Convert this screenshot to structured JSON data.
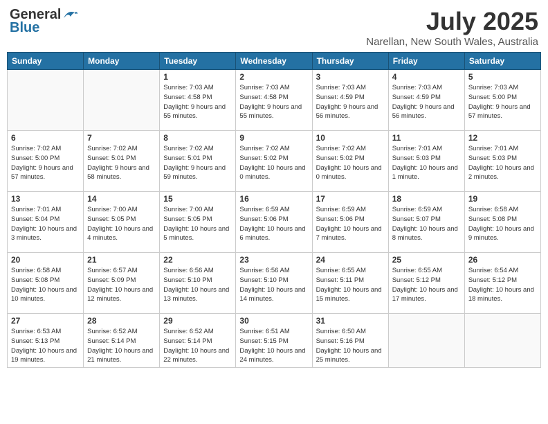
{
  "header": {
    "logo_general": "General",
    "logo_blue": "Blue",
    "month_year": "July 2025",
    "location": "Narellan, New South Wales, Australia"
  },
  "columns": [
    "Sunday",
    "Monday",
    "Tuesday",
    "Wednesday",
    "Thursday",
    "Friday",
    "Saturday"
  ],
  "weeks": [
    [
      {
        "day": "",
        "info": ""
      },
      {
        "day": "",
        "info": ""
      },
      {
        "day": "1",
        "info": "Sunrise: 7:03 AM\nSunset: 4:58 PM\nDaylight: 9 hours and 55 minutes."
      },
      {
        "day": "2",
        "info": "Sunrise: 7:03 AM\nSunset: 4:58 PM\nDaylight: 9 hours and 55 minutes."
      },
      {
        "day": "3",
        "info": "Sunrise: 7:03 AM\nSunset: 4:59 PM\nDaylight: 9 hours and 56 minutes."
      },
      {
        "day": "4",
        "info": "Sunrise: 7:03 AM\nSunset: 4:59 PM\nDaylight: 9 hours and 56 minutes."
      },
      {
        "day": "5",
        "info": "Sunrise: 7:03 AM\nSunset: 5:00 PM\nDaylight: 9 hours and 57 minutes."
      }
    ],
    [
      {
        "day": "6",
        "info": "Sunrise: 7:02 AM\nSunset: 5:00 PM\nDaylight: 9 hours and 57 minutes."
      },
      {
        "day": "7",
        "info": "Sunrise: 7:02 AM\nSunset: 5:01 PM\nDaylight: 9 hours and 58 minutes."
      },
      {
        "day": "8",
        "info": "Sunrise: 7:02 AM\nSunset: 5:01 PM\nDaylight: 9 hours and 59 minutes."
      },
      {
        "day": "9",
        "info": "Sunrise: 7:02 AM\nSunset: 5:02 PM\nDaylight: 10 hours and 0 minutes."
      },
      {
        "day": "10",
        "info": "Sunrise: 7:02 AM\nSunset: 5:02 PM\nDaylight: 10 hours and 0 minutes."
      },
      {
        "day": "11",
        "info": "Sunrise: 7:01 AM\nSunset: 5:03 PM\nDaylight: 10 hours and 1 minute."
      },
      {
        "day": "12",
        "info": "Sunrise: 7:01 AM\nSunset: 5:03 PM\nDaylight: 10 hours and 2 minutes."
      }
    ],
    [
      {
        "day": "13",
        "info": "Sunrise: 7:01 AM\nSunset: 5:04 PM\nDaylight: 10 hours and 3 minutes."
      },
      {
        "day": "14",
        "info": "Sunrise: 7:00 AM\nSunset: 5:05 PM\nDaylight: 10 hours and 4 minutes."
      },
      {
        "day": "15",
        "info": "Sunrise: 7:00 AM\nSunset: 5:05 PM\nDaylight: 10 hours and 5 minutes."
      },
      {
        "day": "16",
        "info": "Sunrise: 6:59 AM\nSunset: 5:06 PM\nDaylight: 10 hours and 6 minutes."
      },
      {
        "day": "17",
        "info": "Sunrise: 6:59 AM\nSunset: 5:06 PM\nDaylight: 10 hours and 7 minutes."
      },
      {
        "day": "18",
        "info": "Sunrise: 6:59 AM\nSunset: 5:07 PM\nDaylight: 10 hours and 8 minutes."
      },
      {
        "day": "19",
        "info": "Sunrise: 6:58 AM\nSunset: 5:08 PM\nDaylight: 10 hours and 9 minutes."
      }
    ],
    [
      {
        "day": "20",
        "info": "Sunrise: 6:58 AM\nSunset: 5:08 PM\nDaylight: 10 hours and 10 minutes."
      },
      {
        "day": "21",
        "info": "Sunrise: 6:57 AM\nSunset: 5:09 PM\nDaylight: 10 hours and 12 minutes."
      },
      {
        "day": "22",
        "info": "Sunrise: 6:56 AM\nSunset: 5:10 PM\nDaylight: 10 hours and 13 minutes."
      },
      {
        "day": "23",
        "info": "Sunrise: 6:56 AM\nSunset: 5:10 PM\nDaylight: 10 hours and 14 minutes."
      },
      {
        "day": "24",
        "info": "Sunrise: 6:55 AM\nSunset: 5:11 PM\nDaylight: 10 hours and 15 minutes."
      },
      {
        "day": "25",
        "info": "Sunrise: 6:55 AM\nSunset: 5:12 PM\nDaylight: 10 hours and 17 minutes."
      },
      {
        "day": "26",
        "info": "Sunrise: 6:54 AM\nSunset: 5:12 PM\nDaylight: 10 hours and 18 minutes."
      }
    ],
    [
      {
        "day": "27",
        "info": "Sunrise: 6:53 AM\nSunset: 5:13 PM\nDaylight: 10 hours and 19 minutes."
      },
      {
        "day": "28",
        "info": "Sunrise: 6:52 AM\nSunset: 5:14 PM\nDaylight: 10 hours and 21 minutes."
      },
      {
        "day": "29",
        "info": "Sunrise: 6:52 AM\nSunset: 5:14 PM\nDaylight: 10 hours and 22 minutes."
      },
      {
        "day": "30",
        "info": "Sunrise: 6:51 AM\nSunset: 5:15 PM\nDaylight: 10 hours and 24 minutes."
      },
      {
        "day": "31",
        "info": "Sunrise: 6:50 AM\nSunset: 5:16 PM\nDaylight: 10 hours and 25 minutes."
      },
      {
        "day": "",
        "info": ""
      },
      {
        "day": "",
        "info": ""
      }
    ]
  ]
}
